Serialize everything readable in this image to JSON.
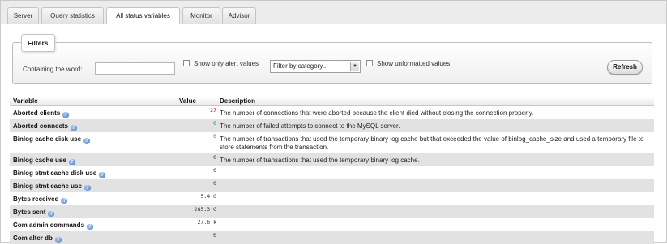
{
  "tabs": [
    {
      "label": "Server",
      "active": false
    },
    {
      "label": "Query statistics",
      "active": false
    },
    {
      "label": "All status variables",
      "active": true
    },
    {
      "label": "Monitor",
      "active": false
    },
    {
      "label": "Advisor",
      "active": false
    }
  ],
  "filters": {
    "legend": "Filters",
    "containing_label": "Containing the word:",
    "containing_value": "",
    "alert_label": "Show only alert values",
    "alert_checked": false,
    "category_selected": "Filter by category...",
    "unformatted_label": "Show unformatted values",
    "unformatted_checked": false,
    "refresh_label": "Refresh"
  },
  "table": {
    "headers": {
      "variable": "Variable",
      "value": "Value",
      "description": "Description"
    },
    "rows": [
      {
        "name": "Aborted clients",
        "value": "27",
        "value_color": "red",
        "description": "The number of connections that were aborted because the client died without closing the connection properly."
      },
      {
        "name": "Aborted connects",
        "value": "0",
        "value_color": "green",
        "description": "The number of failed attempts to connect to the MySQL server."
      },
      {
        "name": "Binlog cache disk use",
        "value": "0",
        "value_color": "green",
        "description": "The number of transactions that used the temporary binary log cache but that exceeded the value of binlog_cache_size and used a temporary file to store statements from the transaction."
      },
      {
        "name": "Binlog cache use",
        "value": "0",
        "value_color": "plain",
        "description": "The number of transactions that used the temporary binary log cache."
      },
      {
        "name": "Binlog stmt cache disk use",
        "value": "0",
        "value_color": "plain",
        "description": ""
      },
      {
        "name": "Binlog stmt cache use",
        "value": "0",
        "value_color": "plain",
        "description": ""
      },
      {
        "name": "Bytes received",
        "value": "5.4 G",
        "value_color": "plain",
        "description": ""
      },
      {
        "name": "Bytes sent",
        "value": "285.3 G",
        "value_color": "plain",
        "description": ""
      },
      {
        "name": "Com admin commands",
        "value": "27.6 k",
        "value_color": "plain",
        "description": ""
      },
      {
        "name": "Com alter db",
        "value": "0",
        "value_color": "plain",
        "description": ""
      }
    ]
  },
  "icons": {
    "help": "help-icon",
    "dropdown": "chevron-down-icon"
  },
  "colors": {
    "alert_value": "#d00000",
    "ok_value": "#1a9a1a",
    "row_alt": "#e2e2e2"
  }
}
